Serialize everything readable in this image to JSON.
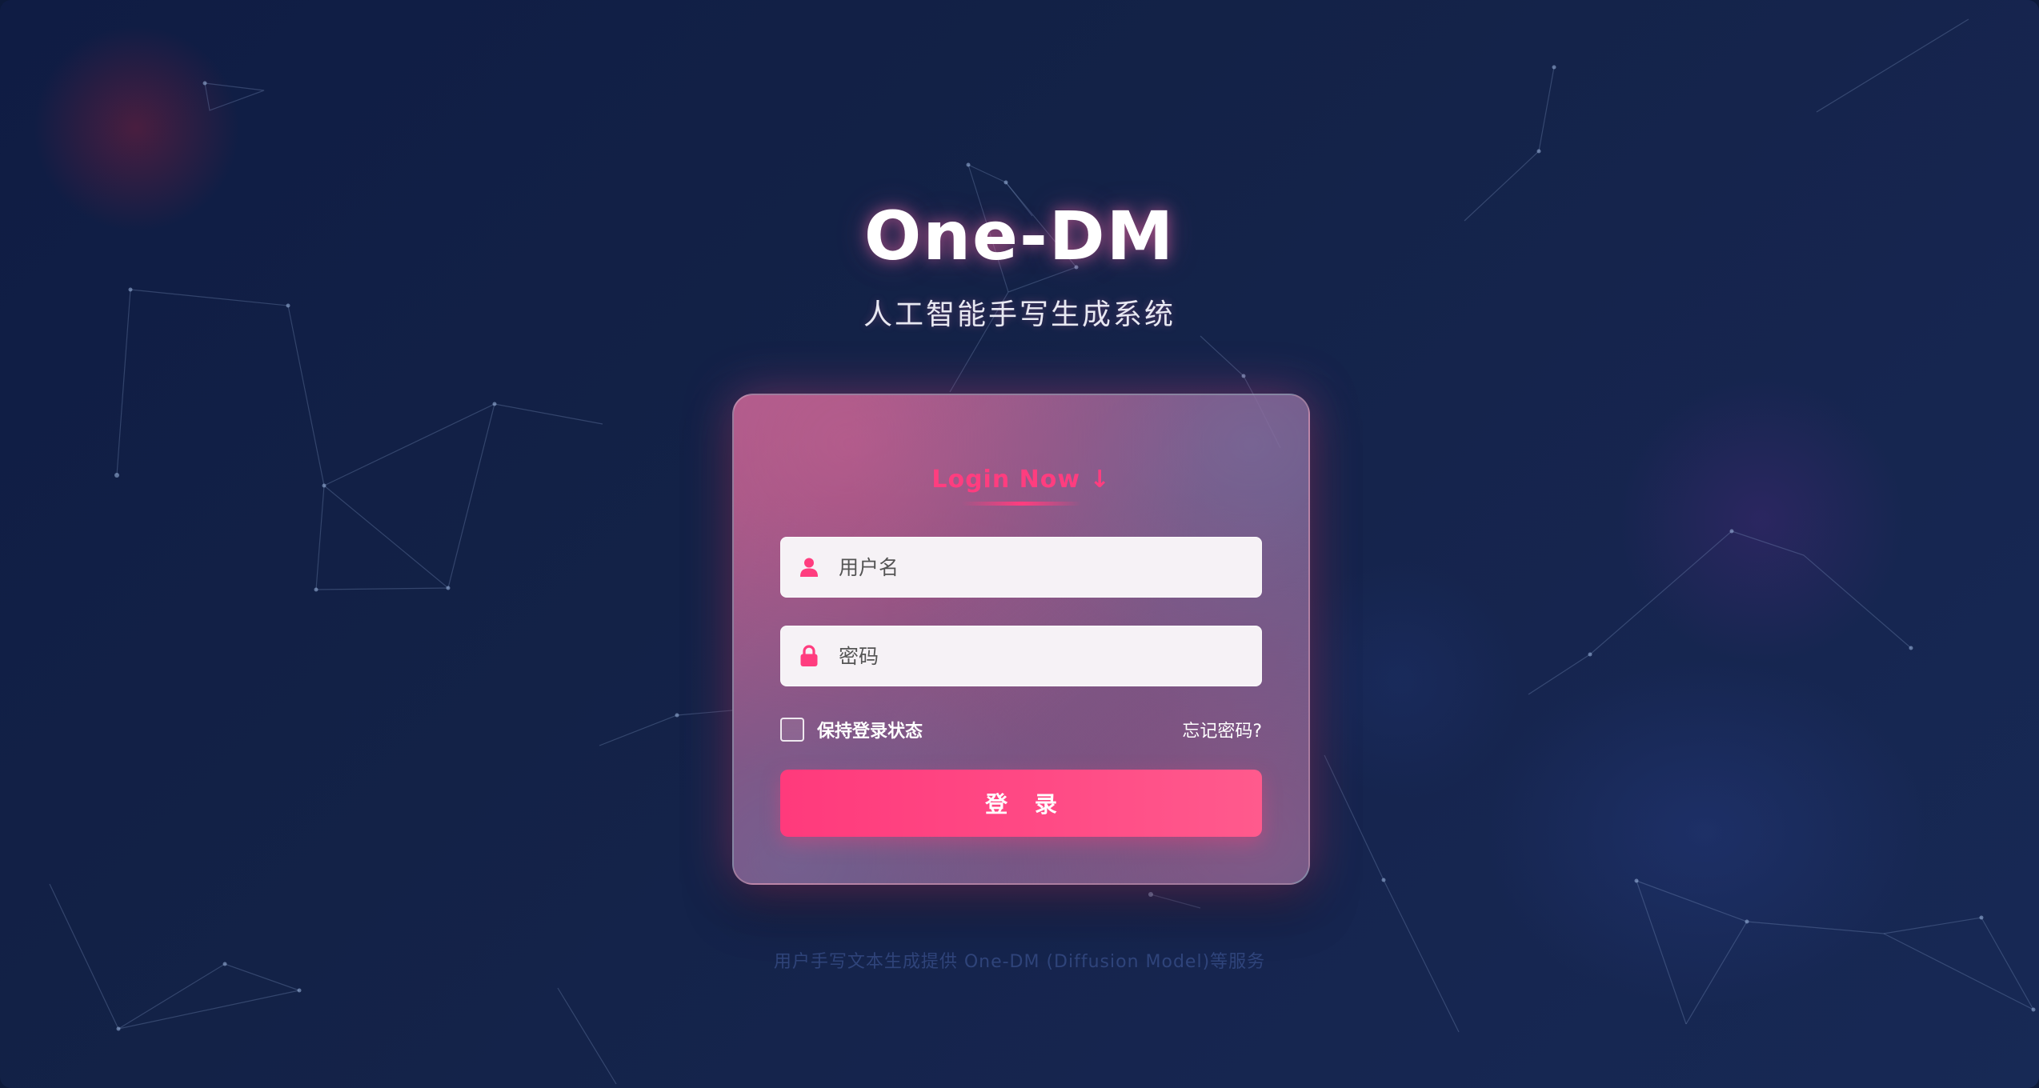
{
  "header": {
    "title": "One-DM",
    "subtitle": "人工智能手写生成系统"
  },
  "login_card": {
    "heading": "Login Now ↓",
    "username_placeholder": "用户名",
    "password_placeholder": "密码",
    "remember_label": "保持登录状态",
    "forgot_label": "忘记密码?",
    "submit_label": "登 录"
  },
  "footer": {
    "note": "用户手写文本生成提供 One-DM (Diffusion Model)等服务"
  },
  "colors": {
    "accent": "#ff3d7f",
    "background": "#132247",
    "title_text": "#ffffff"
  },
  "icons": {
    "username": "user-icon",
    "password": "lock-icon"
  }
}
